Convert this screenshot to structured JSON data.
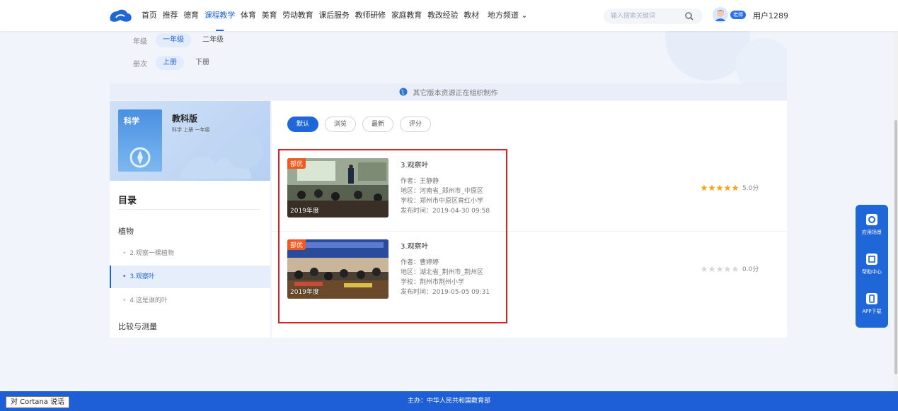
{
  "header": {
    "nav": [
      "首页",
      "推荐",
      "德育",
      "课程教学",
      "体育",
      "美育",
      "劳动教育",
      "课后服务",
      "教师研修",
      "家庭教育",
      "教改经验",
      "教材"
    ],
    "nav_more": "地方频道 ⌄",
    "search_placeholder": "输入搜索关键词",
    "role_badge": "老师",
    "user_name": "用户1289"
  },
  "filters": {
    "grade_label": "年级",
    "grades": [
      "一年级",
      "二年级"
    ],
    "volume_label": "册次",
    "volumes": [
      "上册",
      "下册"
    ]
  },
  "notice": "其它版本资源正在组织制作",
  "book": {
    "cover_title": "科学",
    "edition": "教科版",
    "subtitle": "科学 上册 一年级"
  },
  "toc": {
    "title": "目录",
    "units": [
      "植物",
      "比较与测量"
    ],
    "lessons": [
      "2.观察一棵植物",
      "3.观察叶",
      "4.这是谁的叶"
    ]
  },
  "sort_tabs": [
    "默认",
    "浏览",
    "最新",
    "评分"
  ],
  "resources": [
    {
      "badge": "部优",
      "year": "2019年度",
      "title": "3.观察叶",
      "author": "作者：王静静",
      "region": "地区：河南省_郑州市_中原区",
      "school": "学校：郑州市中原区育红小学",
      "date": "发布时间：2019-04-30 09:58",
      "rating": 5,
      "score": "5.0分"
    },
    {
      "badge": "部优",
      "year": "2019年度",
      "title": "3.观察叶",
      "author": "作者：曹婷婷",
      "region": "地区：湖北省_荆州市_荆州区",
      "school": "学校：荆州市荆州小学",
      "date": "发布时间：2019-05-05 09:31",
      "rating": 0,
      "score": "0.0分"
    }
  ],
  "float_bar": [
    "应用场景",
    "帮助中心",
    "APP下载"
  ],
  "footer": "主办：中华人民共和国教育部",
  "cortana": "对 Cortana 说话",
  "colors": {
    "brand": "#1f66d9",
    "badge": "#ef5a20",
    "highlight": "#e02020",
    "star": "#f5a623"
  }
}
